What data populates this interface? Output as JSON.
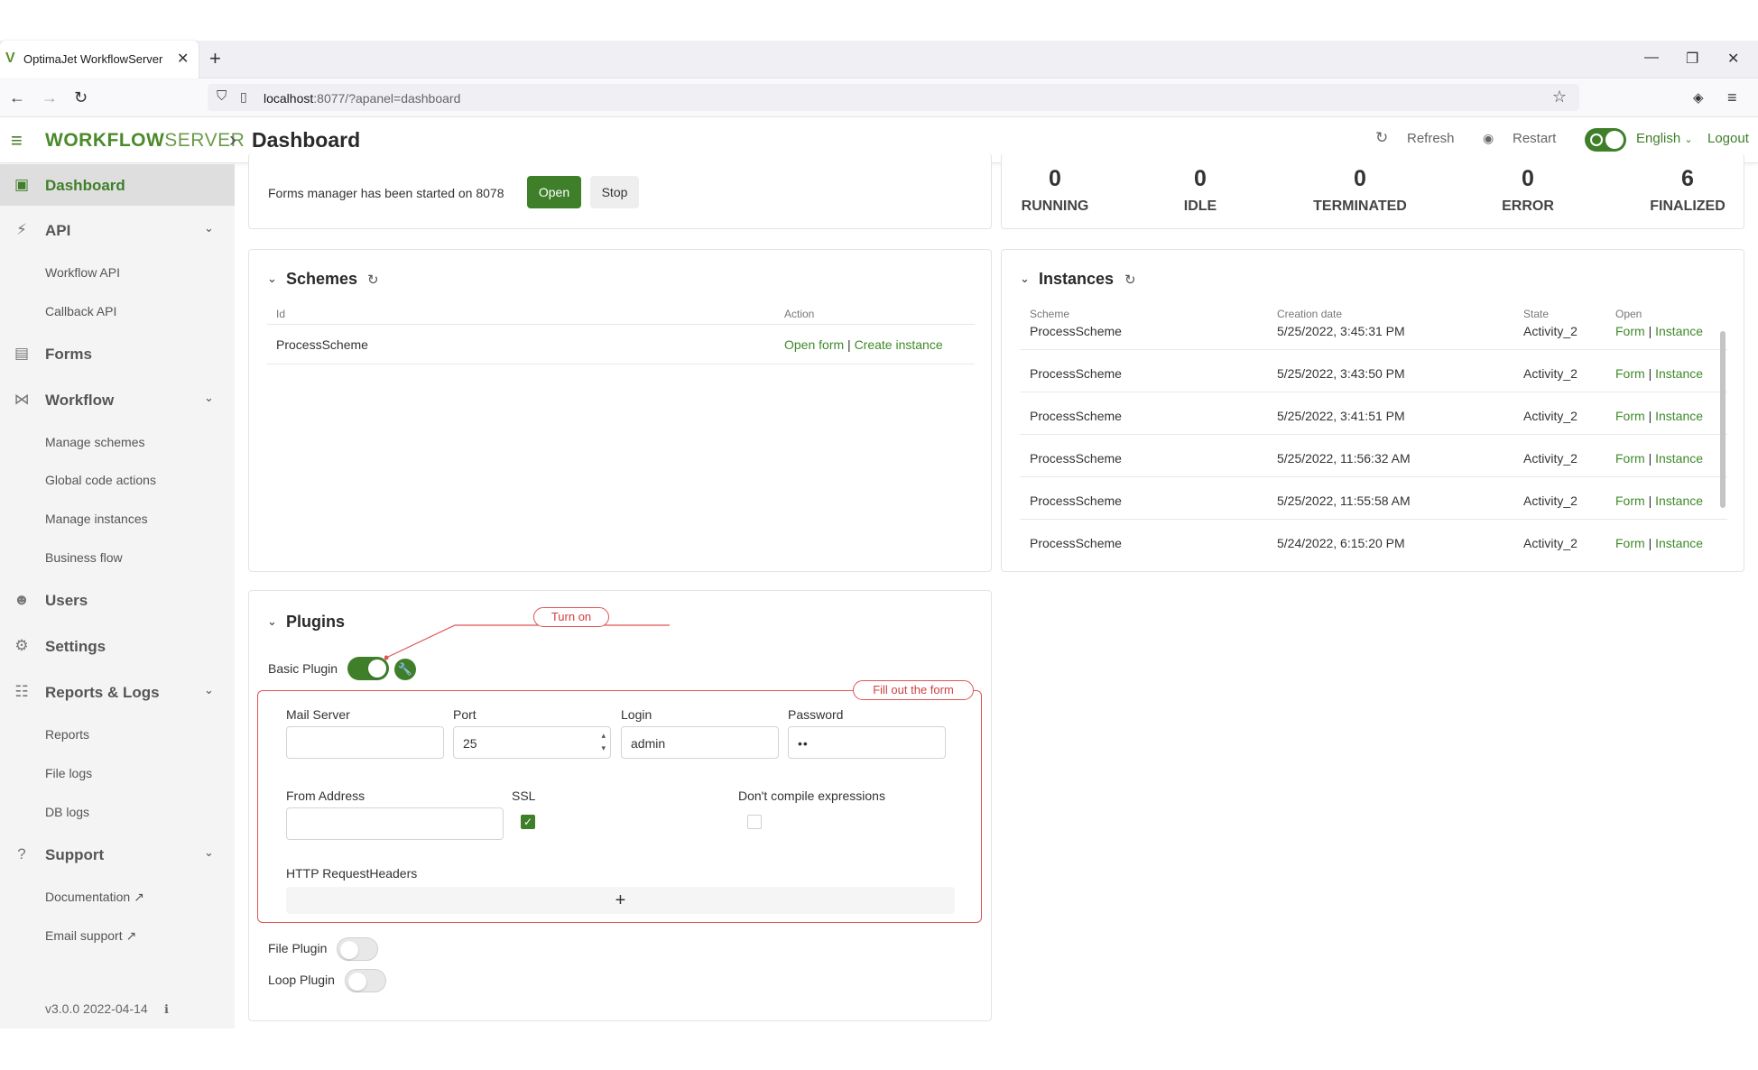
{
  "browser": {
    "tab_title": "OptimaJet WorkflowServer",
    "url_host": "localhost",
    "url_rest": ":8077/?apanel=dashboard"
  },
  "header": {
    "brand_a": "WORKFLOW",
    "brand_b": "SERVER",
    "page_title": "Dashboard",
    "refresh_label": "Refresh",
    "restart_label": "Restart",
    "language": "English",
    "logout_label": "Logout"
  },
  "sidebar": {
    "dashboard": "Dashboard",
    "api": "API",
    "workflow_api": "Workflow API",
    "callback_api": "Callback API",
    "forms": "Forms",
    "workflow": "Workflow",
    "manage_schemes": "Manage schemes",
    "global_code_actions": "Global code actions",
    "manage_instances": "Manage instances",
    "business_flow": "Business flow",
    "users": "Users",
    "settings": "Settings",
    "reports_logs": "Reports & Logs",
    "reports": "Reports",
    "file_logs": "File logs",
    "db_logs": "DB logs",
    "support": "Support",
    "documentation": "Documentation",
    "email_support": "Email support",
    "version": "v3.0.0 2022-04-14"
  },
  "forms_manager": {
    "message": "Forms manager has been started on 8078",
    "open_label": "Open",
    "stop_label": "Stop"
  },
  "stats": [
    {
      "value": "0",
      "label": "RUNNING"
    },
    {
      "value": "0",
      "label": "IDLE"
    },
    {
      "value": "0",
      "label": "TERMINATED"
    },
    {
      "value": "0",
      "label": "ERROR"
    },
    {
      "value": "6",
      "label": "FINALIZED"
    }
  ],
  "schemes": {
    "title": "Schemes",
    "col_id": "Id",
    "col_action": "Action",
    "rows": [
      {
        "id": "ProcessScheme",
        "open_form": "Open form",
        "sep": "|",
        "create_instance": "Create instance"
      }
    ]
  },
  "instances": {
    "title": "Instances",
    "col_scheme": "Scheme",
    "col_date": "Creation date",
    "col_state": "State",
    "col_open": "Open",
    "rows": [
      {
        "scheme": "ProcessScheme",
        "date": "5/25/2022, 3:45:31 PM",
        "state": "Activity_2",
        "form": "Form",
        "sep": "|",
        "instance": "Instance"
      },
      {
        "scheme": "ProcessScheme",
        "date": "5/25/2022, 3:43:50 PM",
        "state": "Activity_2",
        "form": "Form",
        "sep": "|",
        "instance": "Instance"
      },
      {
        "scheme": "ProcessScheme",
        "date": "5/25/2022, 3:41:51 PM",
        "state": "Activity_2",
        "form": "Form",
        "sep": "|",
        "instance": "Instance"
      },
      {
        "scheme": "ProcessScheme",
        "date": "5/25/2022, 11:56:32 AM",
        "state": "Activity_2",
        "form": "Form",
        "sep": "|",
        "instance": "Instance"
      },
      {
        "scheme": "ProcessScheme",
        "date": "5/25/2022, 11:55:58 AM",
        "state": "Activity_2",
        "form": "Form",
        "sep": "|",
        "instance": "Instance"
      },
      {
        "scheme": "ProcessScheme",
        "date": "5/24/2022, 6:15:20 PM",
        "state": "Activity_2",
        "form": "Form",
        "sep": "|",
        "instance": "Instance"
      }
    ]
  },
  "plugins": {
    "title": "Plugins",
    "basic_plugin": "Basic Plugin",
    "annotation_turn_on": "Turn on",
    "annotation_fill_form": "Fill out the form",
    "mail_server_label": "Mail Server",
    "mail_server_value": "",
    "port_label": "Port",
    "port_value": "25",
    "login_label": "Login",
    "login_value": "admin",
    "password_label": "Password",
    "password_value": "••",
    "from_address_label": "From Address",
    "from_address_value": "",
    "ssl_label": "SSL",
    "dont_compile_label": "Don't compile expressions",
    "http_headers_label": "HTTP RequestHeaders",
    "file_plugin": "File Plugin",
    "loop_plugin": "Loop Plugin"
  },
  "colors": {
    "accent": "#3f7f2a",
    "annotation": "#e05555"
  }
}
